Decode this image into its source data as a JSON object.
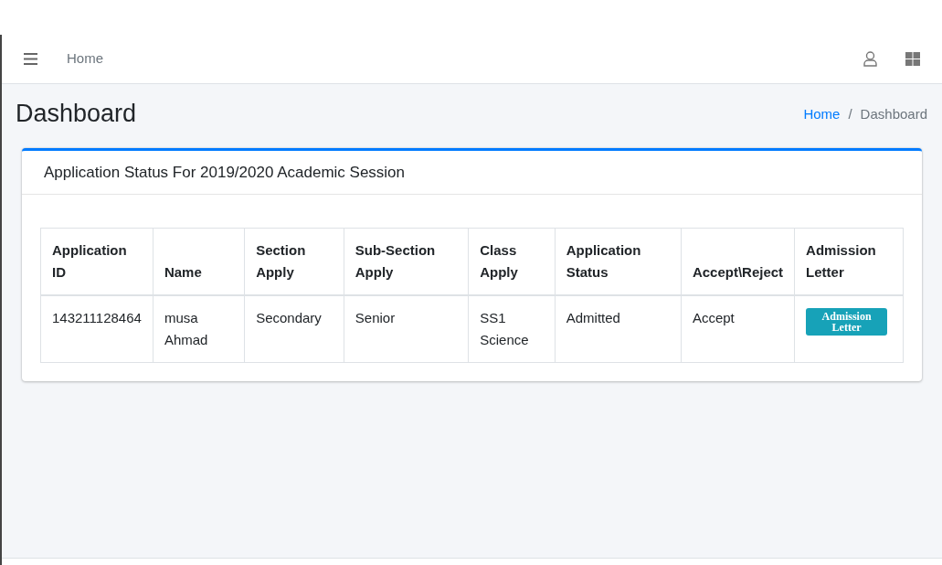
{
  "navbar": {
    "link": "Home"
  },
  "header": {
    "title": "Dashboard",
    "breadcrumb_separator": "/",
    "breadcrumb": [
      {
        "label": "Home",
        "link": true
      },
      {
        "label": "Dashboard",
        "link": false
      }
    ]
  },
  "card": {
    "title": "Application Status For 2019/2020 Academic Session",
    "table": {
      "columns": [
        "Application ID",
        "Name",
        "Section Apply",
        "Sub-Section Apply",
        "Class Apply",
        "Application Status",
        "Accept\\Reject",
        "Admission Letter"
      ],
      "rows": [
        {
          "cells": [
            "143211128464",
            "musa Ahmad",
            "Secondary",
            "Senior",
            "SS1 Science",
            "Admitted",
            "Accept"
          ],
          "button": "Admission Letter"
        }
      ]
    }
  }
}
